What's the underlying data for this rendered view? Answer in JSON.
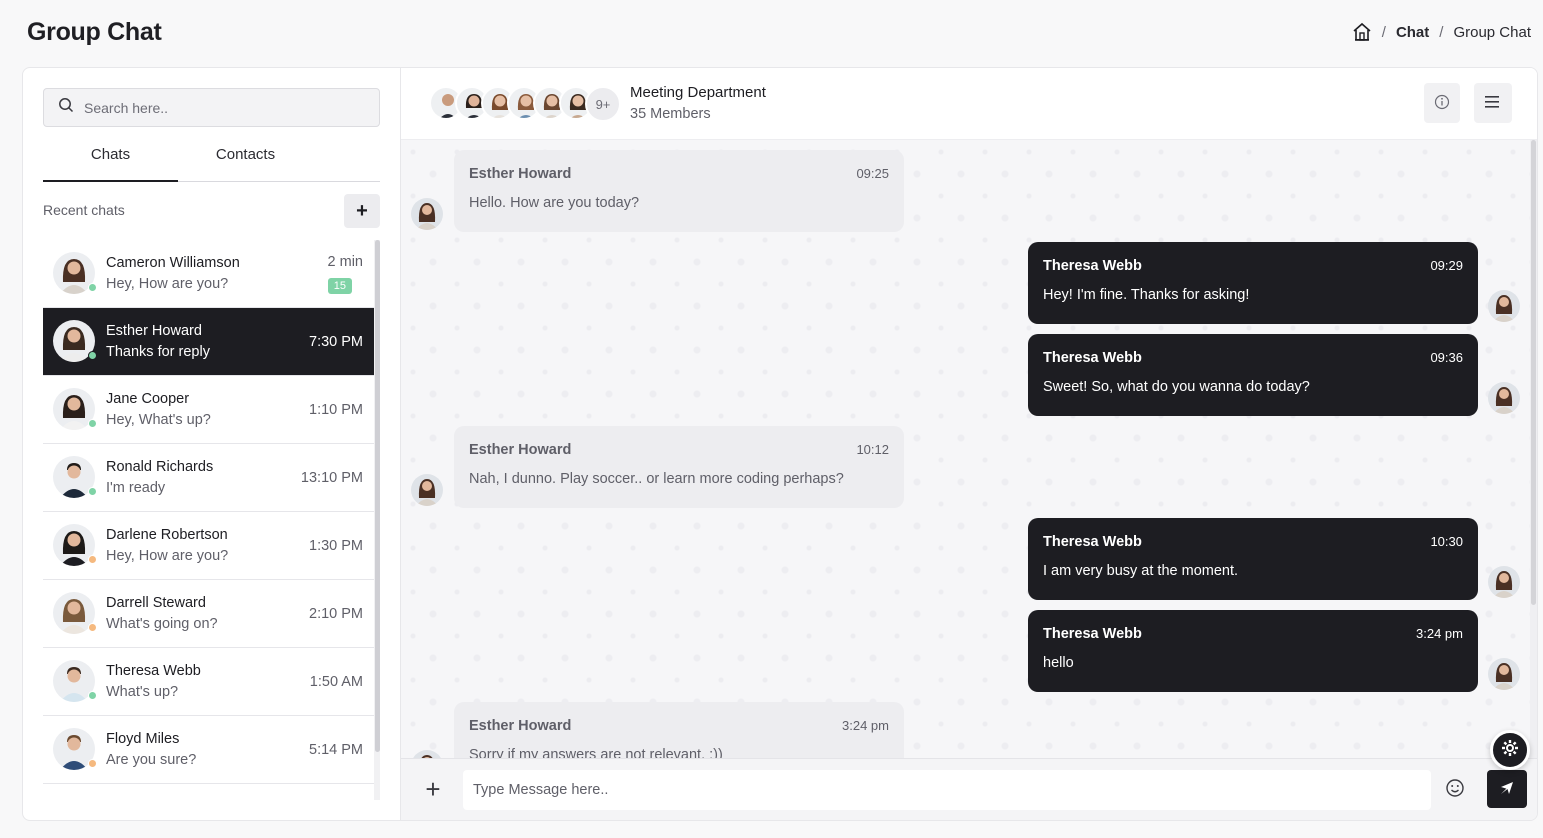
{
  "page": {
    "title": "Group Chat"
  },
  "breadcrumb": {
    "items": [
      "Chat",
      "Group Chat"
    ],
    "separator": "/"
  },
  "sidebar": {
    "search_placeholder": "Search here..",
    "tabs": [
      "Chats",
      "Contacts"
    ],
    "active_tab": "Chats",
    "recent_label": "Recent chats",
    "add_label": "+",
    "chats": [
      {
        "name": "Cameron Williamson",
        "preview": "Hey, How are you?",
        "time": "2 min",
        "badge": "15",
        "status": "online"
      },
      {
        "name": "Esther Howard",
        "preview": "Thanks for reply",
        "time": "7:30 PM",
        "status": "online",
        "selected": true
      },
      {
        "name": "Jane Cooper",
        "preview": "Hey, What's up?",
        "time": "1:10 PM",
        "status": "online"
      },
      {
        "name": "Ronald Richards",
        "preview": "I'm ready",
        "time": "13:10 PM",
        "status": "online"
      },
      {
        "name": "Darlene Robertson",
        "preview": "Hey, How are you?",
        "time": "1:30 PM",
        "status": "away"
      },
      {
        "name": "Darrell Steward",
        "preview": "What's going on?",
        "time": "2:10 PM",
        "status": "away"
      },
      {
        "name": "Theresa Webb",
        "preview": "What's up?",
        "time": "1:50 AM",
        "status": "online"
      },
      {
        "name": "Floyd Miles",
        "preview": "Are you sure?",
        "time": "5:14 PM",
        "status": "away"
      }
    ]
  },
  "conversation": {
    "group_name": "Meeting Department",
    "members_label": "35 Members",
    "more_members": "9+",
    "messages": [
      {
        "sender": "Esther Howard",
        "time": "09:25",
        "text": "Hello. How are you today?",
        "direction": "in"
      },
      {
        "sender": "Theresa Webb",
        "time": "09:29",
        "text": "Hey! I'm fine. Thanks for asking!",
        "direction": "out"
      },
      {
        "sender": "Theresa Webb",
        "time": "09:36",
        "text": "Sweet! So, what do you wanna do today?",
        "direction": "out"
      },
      {
        "sender": "Esther Howard",
        "time": "10:12",
        "text": "Nah, I dunno. Play soccer.. or learn more coding perhaps?",
        "direction": "in"
      },
      {
        "sender": "Theresa Webb",
        "time": "10:30",
        "text": "I am very busy at the moment.",
        "direction": "out"
      },
      {
        "sender": "Theresa Webb",
        "time": "3:24 pm",
        "text": "hello",
        "direction": "out"
      },
      {
        "sender": "Esther Howard",
        "time": "3:24 pm",
        "text": "Sorry if my answers are not relevant. :))",
        "direction": "in"
      }
    ]
  },
  "composer": {
    "placeholder": "Type Message here..",
    "attach_label": "+"
  },
  "icons": {
    "home": "home-icon",
    "search": "search-icon",
    "info": "info-icon",
    "menu": "menu-icon",
    "emoji": "emoji-icon",
    "send": "send-icon",
    "settings": "gear-icon"
  },
  "colors": {
    "accent": "#1d1d22",
    "online": "#7fd3a6",
    "away": "#f5b97f",
    "badge": "#7fd3a6"
  }
}
